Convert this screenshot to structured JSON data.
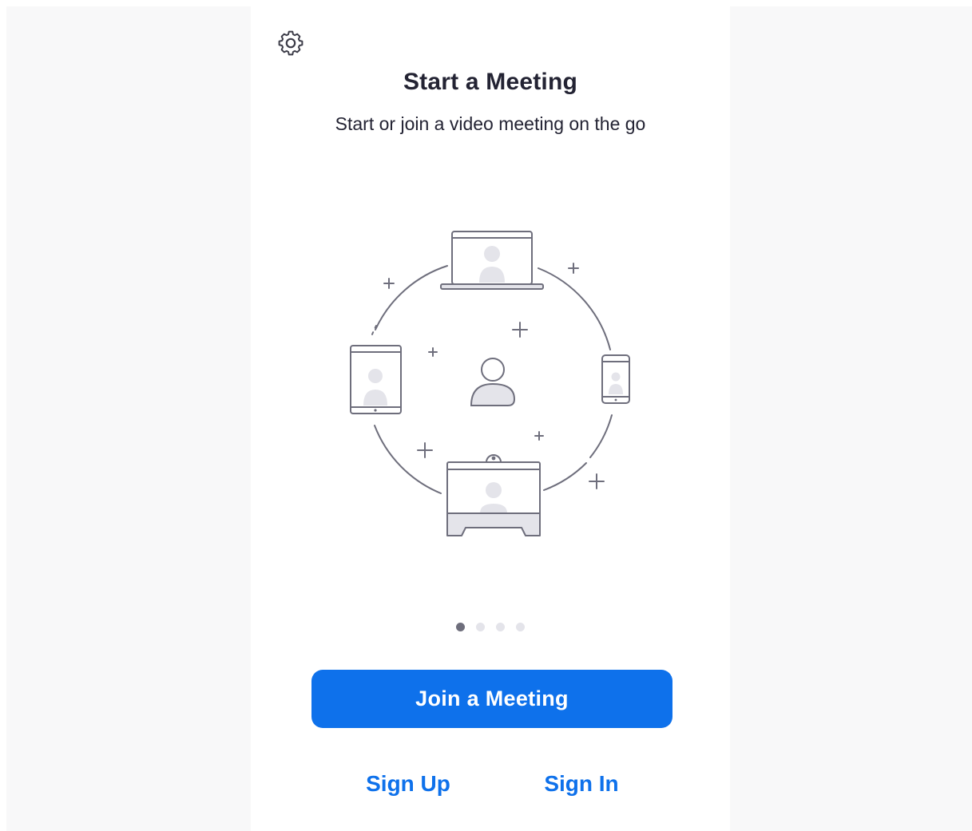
{
  "header": {
    "settings_icon": "gear-icon"
  },
  "main": {
    "title": "Start a Meeting",
    "subtitle": "Start or join a video meeting on the go",
    "illustration_icons": [
      "laptop-icon",
      "tablet-icon",
      "phone-icon",
      "room-system-icon",
      "user-icon",
      "plus-icon"
    ],
    "pager": {
      "total": 4,
      "active": 1
    }
  },
  "actions": {
    "join_label": "Join a Meeting",
    "sign_up_label": "Sign Up",
    "sign_in_label": "Sign In"
  },
  "colors": {
    "accent": "#0e71eb",
    "title_text": "#232333",
    "illustration_stroke": "#6e6e7c",
    "illustration_fill": "#e4e4ea"
  }
}
